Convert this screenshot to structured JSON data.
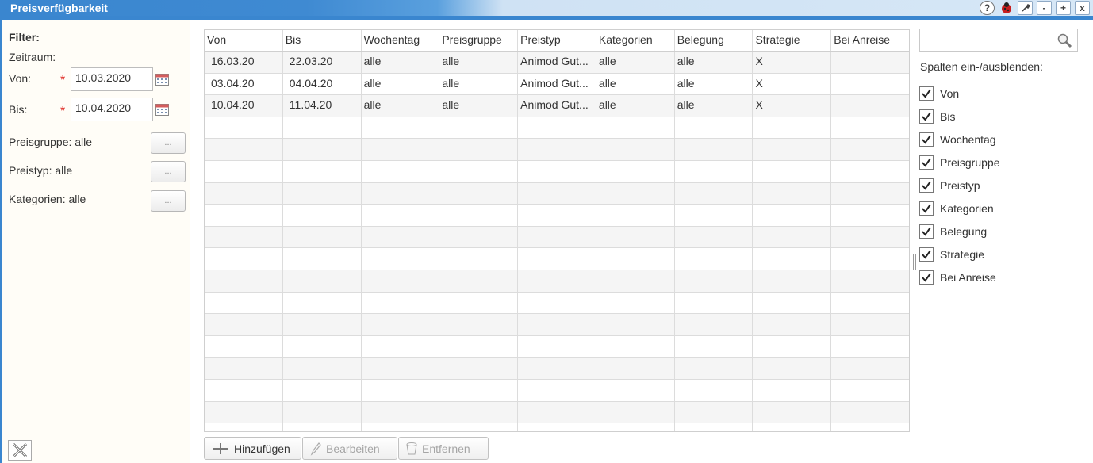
{
  "window": {
    "title": "Preisverfügbarkeit",
    "icons": [
      "help-icon",
      "ladybug-icon",
      "wrench-icon",
      "minimize-icon",
      "maximize-icon",
      "close-icon"
    ],
    "icon_glyphs": [
      "?",
      "●",
      "✎",
      "-",
      "+",
      "x"
    ]
  },
  "filter": {
    "title": "Filter:",
    "zeitraum_label": "Zeitraum:",
    "von_label": "Von:",
    "von_value": "10.03.2020",
    "bis_label": "Bis:",
    "bis_value": "10.04.2020",
    "required_mark": "*",
    "preisgruppe_label": "Preisgruppe: alle",
    "preistyp_label": "Preistyp: alle",
    "kategorien_label": "Kategorien: alle",
    "dots": "..."
  },
  "grid": {
    "columns": [
      "Von",
      "Bis",
      "Wochentag",
      "Preisgruppe",
      "Preistyp",
      "Kategorien",
      "Belegung",
      "Strategie",
      "Bei Anreise"
    ],
    "rows": [
      [
        "16.03.20",
        "22.03.20",
        "alle",
        "alle",
        "Animod Gut...",
        "alle",
        "alle",
        "X",
        ""
      ],
      [
        "03.04.20",
        "04.04.20",
        "alle",
        "alle",
        "Animod Gut...",
        "alle",
        "alle",
        "X",
        ""
      ],
      [
        "10.04.20",
        "11.04.20",
        "alle",
        "alle",
        "Animod Gut...",
        "alle",
        "alle",
        "X",
        ""
      ]
    ],
    "empty_rows": 15
  },
  "actions": {
    "add_label": "Hinzufügen",
    "edit_label": "Bearbeiten",
    "remove_label": "Entfernen"
  },
  "columns_panel": {
    "search_placeholder": "",
    "title": "Spalten ein-/ausblenden:",
    "items": [
      {
        "label": "Von",
        "checked": true
      },
      {
        "label": "Bis",
        "checked": true
      },
      {
        "label": "Wochentag",
        "checked": true
      },
      {
        "label": "Preisgruppe",
        "checked": true
      },
      {
        "label": "Preistyp",
        "checked": true
      },
      {
        "label": "Kategorien",
        "checked": true
      },
      {
        "label": "Belegung",
        "checked": true
      },
      {
        "label": "Strategie",
        "checked": true
      },
      {
        "label": "Bei Anreise",
        "checked": true
      }
    ]
  },
  "colors": {
    "titlebar": "#3a86cf",
    "filter_bg": "#fffdf7",
    "required": "#e0312b"
  }
}
